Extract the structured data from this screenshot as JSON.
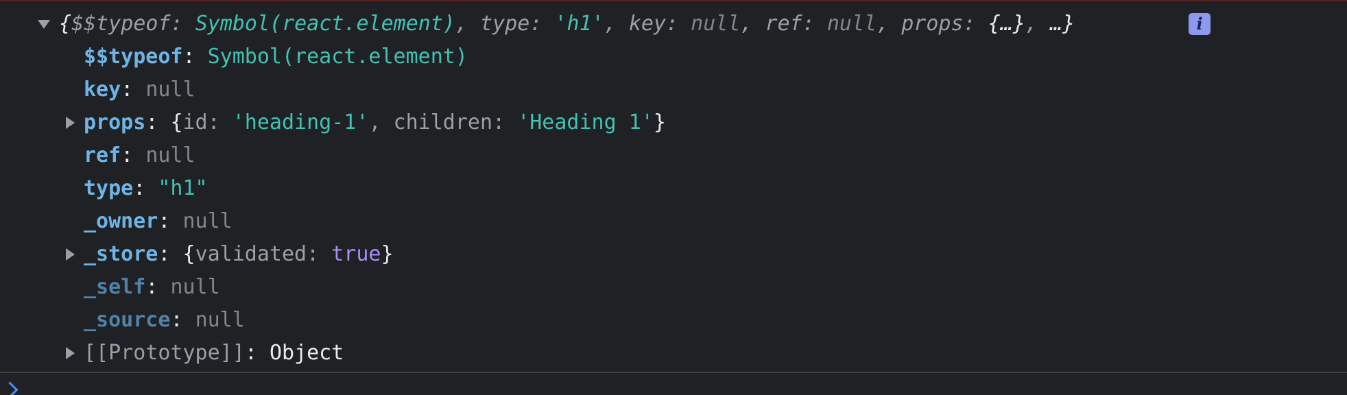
{
  "summary": {
    "open": "{",
    "typeof_key": "$$typeof",
    "typeof_val": "Symbol(react.element)",
    "type_key": "type",
    "type_val": "'h1'",
    "key_key": "key",
    "key_val": "null",
    "ref_key": "ref",
    "ref_val": "null",
    "props_key": "props",
    "props_val": "{…}",
    "more": "…}",
    "info_label": "i"
  },
  "props": [
    {
      "key": "$$typeof",
      "value": "Symbol(react.element)"
    },
    {
      "key": "key",
      "value": "null"
    },
    {
      "key": "props",
      "preview": {
        "open": "{",
        "id_key": "id",
        "id_val": "'heading-1'",
        "children_key": "children",
        "children_val": "'Heading 1'",
        "close": "}"
      }
    },
    {
      "key": "ref",
      "value": "null"
    },
    {
      "key": "type",
      "value": "\"h1\""
    },
    {
      "key": "_owner",
      "value": "null"
    },
    {
      "key": "_store",
      "preview": {
        "open": "{",
        "validated_key": "validated",
        "validated_val": "true",
        "close": "}"
      }
    },
    {
      "key": "_self",
      "value": "null"
    },
    {
      "key": "_source",
      "value": "null"
    },
    {
      "key": "[[Prototype]]",
      "value": "Object"
    }
  ],
  "punct": {
    "colon": ": ",
    "comma": ", "
  },
  "colors": {
    "background": "#202124",
    "key": "#6fb4e6",
    "string": "#41c2b3",
    "boolean": "#a98df8",
    "null": "#80868b",
    "info_badge": "#8c99ee",
    "prompt": "#4c8df6"
  },
  "icons": {
    "expand_open": "triangle-down-icon",
    "expand_closed": "triangle-right-icon",
    "info": "info-icon",
    "prompt": "chevron-right-icon"
  }
}
